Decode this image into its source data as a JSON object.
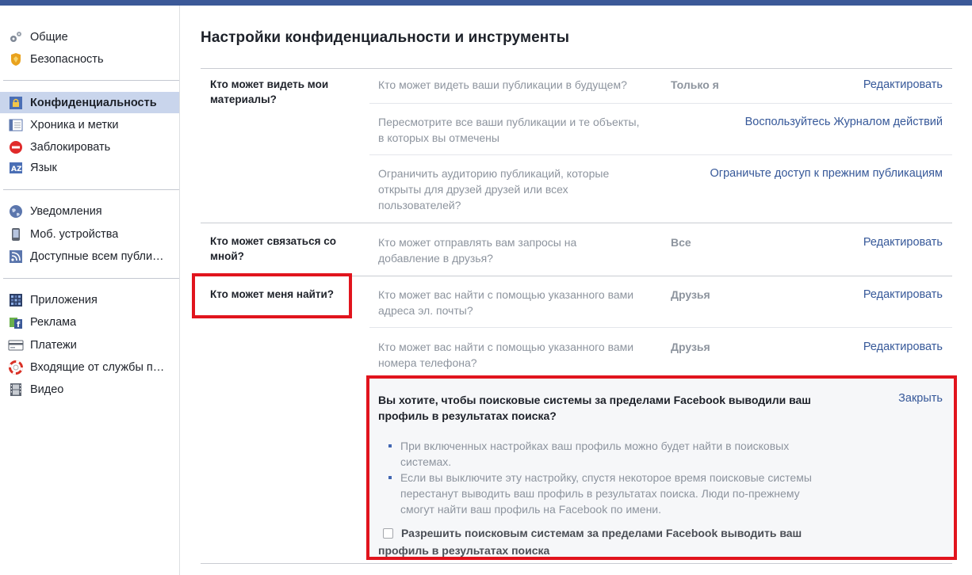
{
  "colors": {
    "topbar": "#3b5998",
    "link": "#365899",
    "highlight_box": "#e1141d",
    "active_item_bg": "#c9d5ec"
  },
  "sidebar": {
    "items": [
      {
        "label": "Общие",
        "icon": "gears-icon"
      },
      {
        "label": "Безопасность",
        "icon": "shield-badge-icon"
      },
      {
        "label": "Конфиденциальность",
        "icon": "lock-icon",
        "active": true
      },
      {
        "label": "Хроника и метки",
        "icon": "timeline-icon"
      },
      {
        "label": "Заблокировать",
        "icon": "block-icon"
      },
      {
        "label": "Язык",
        "icon": "language-icon"
      },
      {
        "label": "Уведомления",
        "icon": "globe-icon"
      },
      {
        "label": "Моб. устройства",
        "icon": "phone-icon"
      },
      {
        "label": "Доступные всем публи…",
        "icon": "rss-icon"
      },
      {
        "label": "Приложения",
        "icon": "apps-icon"
      },
      {
        "label": "Реклама",
        "icon": "ads-icon"
      },
      {
        "label": "Платежи",
        "icon": "card-icon"
      },
      {
        "label": "Входящие от службы п…",
        "icon": "lifebuoy-icon"
      },
      {
        "label": "Видео",
        "icon": "film-icon"
      }
    ]
  },
  "main": {
    "title": "Настройки конфиденциальности и инструменты",
    "sections": [
      {
        "label": "Кто может видеть мои материалы?",
        "rows": [
          {
            "question": "Кто может видеть ваши публикации в будущем?",
            "value": "Только я",
            "action": "Редактировать"
          },
          {
            "question": "Пересмотрите все ваши публикации и те объекты, в которых вы отмечены",
            "value": "",
            "action": "Воспользуйтесь Журналом действий"
          },
          {
            "question": "Ограничить аудиторию публикаций, которые открыты для друзей друзей или всех пользователей?",
            "value": "",
            "action": "Ограничьте доступ к прежним публикациям"
          }
        ]
      },
      {
        "label": "Кто может связаться со мной?",
        "rows": [
          {
            "question": "Кто может отправлять вам запросы на добавление в друзья?",
            "value": "Все",
            "action": "Редактировать"
          }
        ]
      },
      {
        "label": "Кто может меня найти?",
        "rows": [
          {
            "question": "Кто может вас найти с помощью указанного вами адреса эл. почты?",
            "value": "Друзья",
            "action": "Редактировать"
          },
          {
            "question": "Кто может вас найти с помощью указанного вами номера телефона?",
            "value": "Друзья",
            "action": "Редактировать"
          }
        ]
      }
    ],
    "search_panel": {
      "title": "Вы хотите, чтобы поисковые системы за пределами Facebook выводили ваш профиль в результатах поиска?",
      "close": "Закрыть",
      "bullets": [
        "При включенных настройках ваш профиль можно будет найти в поисковых системах.",
        "Если вы выключите эту настройку, спустя некоторое время поисковые системы перестанут выводить ваш профиль в результатах поиска. Люди по-прежнему смогут найти ваш профиль на Facebook по имени."
      ],
      "checkbox_label": "Разрешить поисковым системам за пределами Facebook выводить ваш профиль в результатах поиска",
      "checkbox_checked": false
    }
  }
}
